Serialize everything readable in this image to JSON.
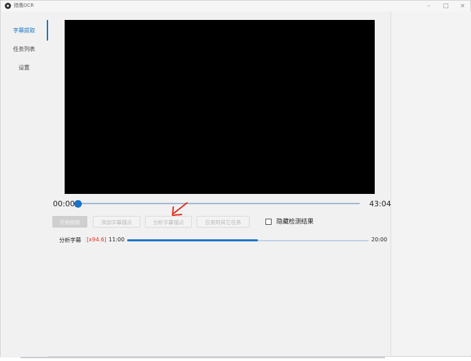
{
  "window": {
    "title": "猎鹰OCR",
    "controls": [
      "–",
      "□",
      "×"
    ]
  },
  "sidebar": {
    "items": [
      {
        "label": "字幕提取",
        "active": true
      },
      {
        "label": "任务列表",
        "active": false
      },
      {
        "label": "设置",
        "active": false
      }
    ]
  },
  "player": {
    "current_time": "00:00",
    "total_time": "43:04",
    "progress": 0
  },
  "actions": {
    "start_label": "开始提取",
    "add_anchor_label": "添加字幕锚点",
    "analyze_anchor_label": "分析字幕锚点",
    "apply_other_label": "应用到其它任务"
  },
  "options": {
    "hide_results_label": "隐藏检测结果",
    "hide_results_checked": false
  },
  "analysis": {
    "label": "分析字幕",
    "speed": "[x94.6]",
    "start_time": "11:00",
    "end_time": "20:00",
    "fraction": 0.54
  },
  "colors": {
    "accent": "#1a73c8",
    "speed": "#e0301e",
    "annotation": "#e03020"
  },
  "icons": {
    "app": "eye-icon",
    "annotation": "arrow-annotation-icon"
  }
}
